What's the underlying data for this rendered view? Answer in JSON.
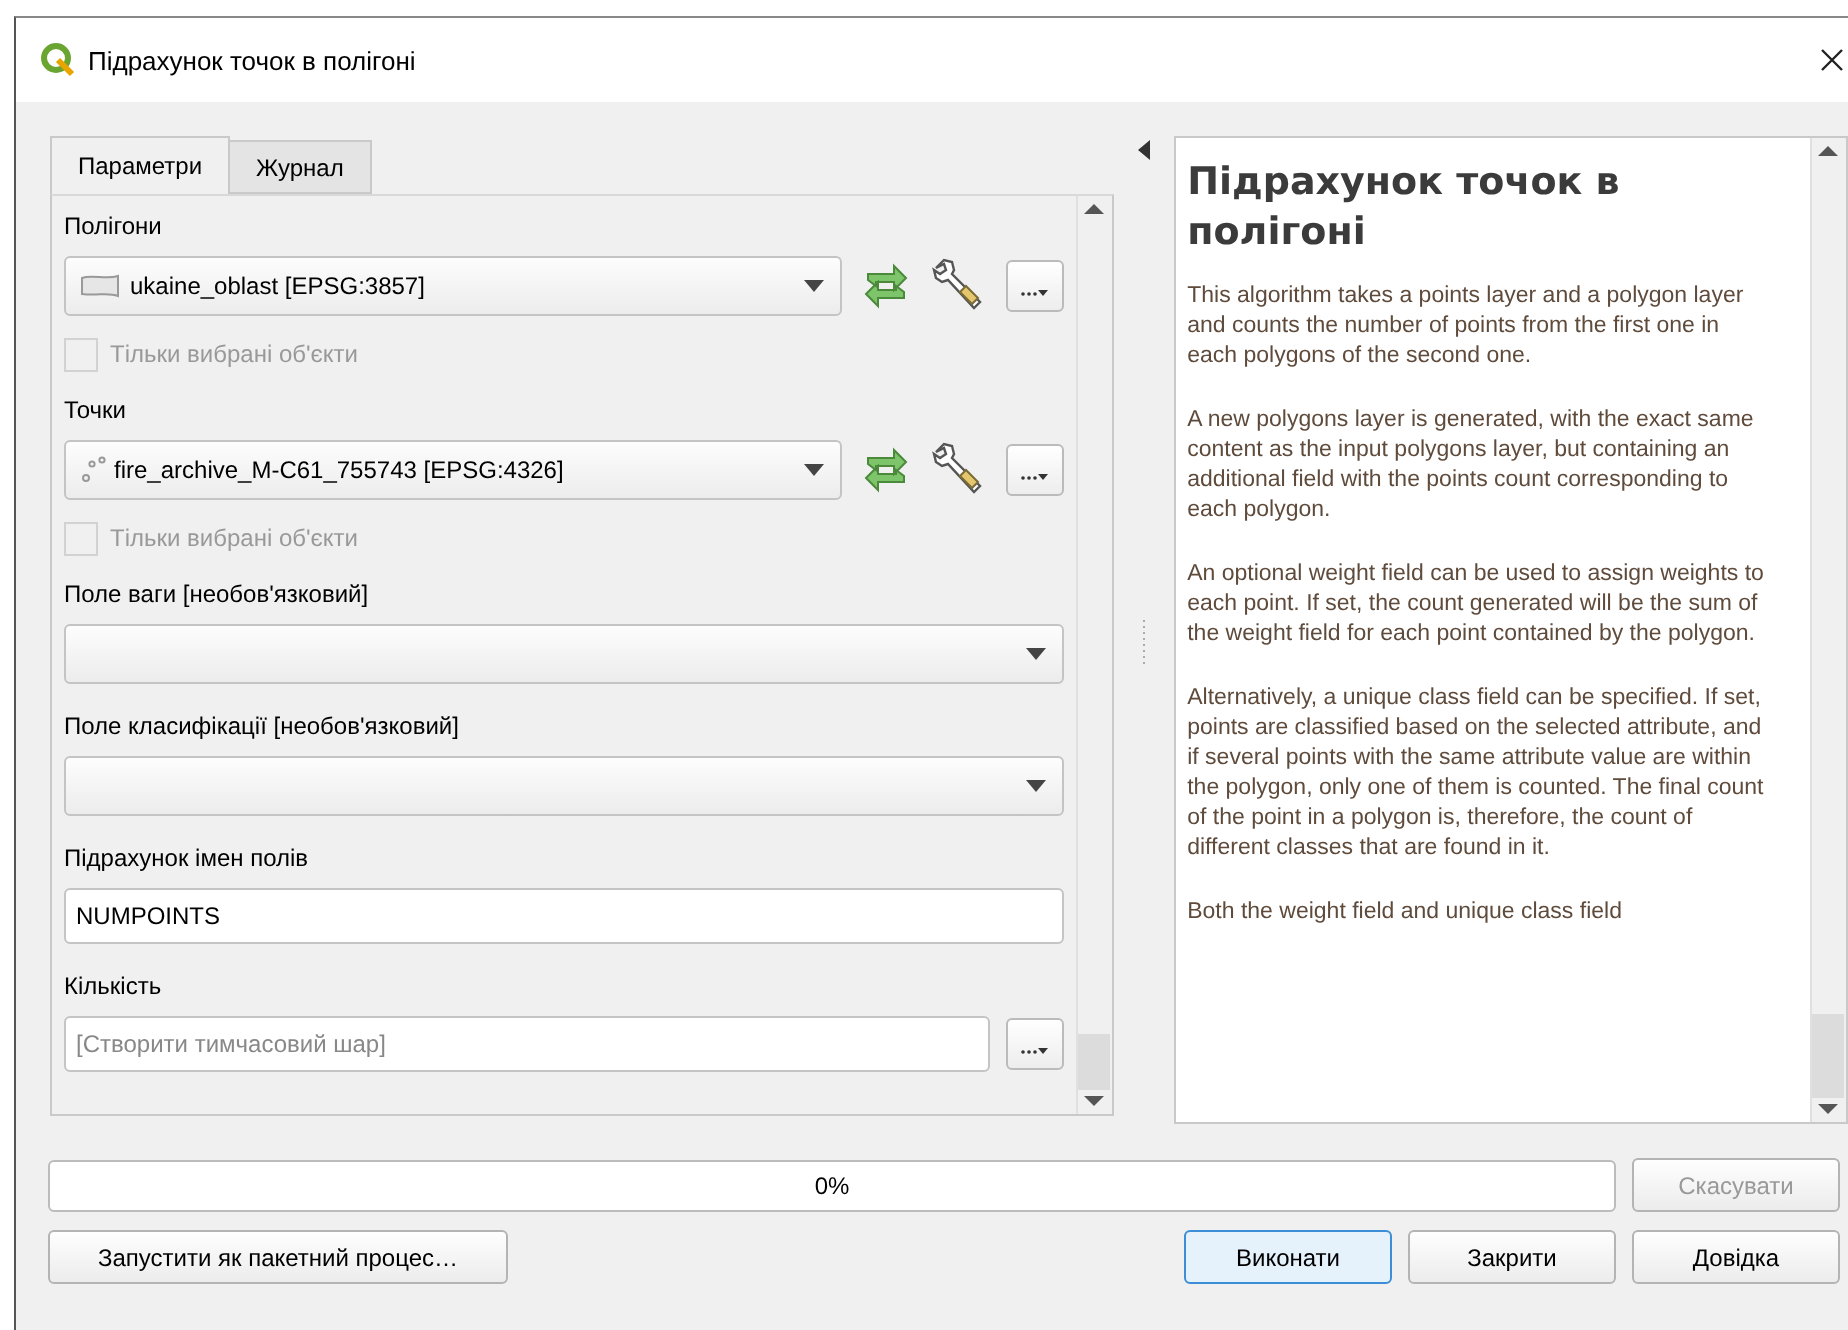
{
  "window": {
    "title": "Підрахунок точок в полігоні"
  },
  "tabs": [
    {
      "label": "Параметри",
      "selected": true
    },
    {
      "label": "Журнал",
      "selected": false
    }
  ],
  "parameters": [
    {
      "kind": "layer",
      "label": "Полігони",
      "layer": {
        "kind": "polygon",
        "value": "ukaine_oblast [EPSG:3857]"
      },
      "selected_only": {
        "label": "Тільки вибрані об'єкти",
        "checked": false,
        "disabled": true
      }
    },
    {
      "kind": "layer",
      "label": "Точки",
      "layer": {
        "kind": "point",
        "value": "fire_archive_M-C61_755743 [EPSG:4326]"
      },
      "selected_only": {
        "label": "Тільки вибрані об'єкти",
        "checked": false,
        "disabled": true
      }
    },
    {
      "kind": "combo",
      "label": "Поле ваги [необов'язковий]"
    },
    {
      "kind": "combo",
      "label": "Поле класифікації [необов'язковий]"
    },
    {
      "kind": "text",
      "label": "Підрахунок імен полів",
      "value": "NUMPOINTS"
    },
    {
      "kind": "file",
      "label": "Кількість",
      "placeholder": "[Створити тимчасовий шар]"
    }
  ],
  "help": {
    "title": "Підрахунок точок в полігоні",
    "paragraphs": [
      "This algorithm takes a points layer and a polygon layer and counts the number of points from the first one in each polygons of the second one.",
      "A new polygons layer is generated, with the exact same content as the input polygons layer, but containing an additional field with the points count corresponding to each polygon.",
      "An optional weight field can be used to assign weights to each point. If set, the count generated will be the sum of the weight field for each point contained by the polygon.",
      "Alternatively, a unique class field can be specified. If set, points are classified based on the selected attribute, and if several points with the same attribute value are within the polygon, only one of them is counted. The final count of the point in a polygon is, therefore, the count of different classes that are found in it.",
      "Both the weight field and unique class field"
    ]
  },
  "progress": {
    "level": 0,
    "reading": "0%"
  },
  "cancel_button": {
    "label": "Скасувати",
    "disabled": true
  },
  "batch_button": {
    "label": "Запустити як пакетний процес…"
  },
  "buttons": [
    {
      "label": "Виконати",
      "default": true
    },
    {
      "label": "Закрити",
      "default": false
    },
    {
      "label": "Довідка",
      "default": false
    }
  ]
}
